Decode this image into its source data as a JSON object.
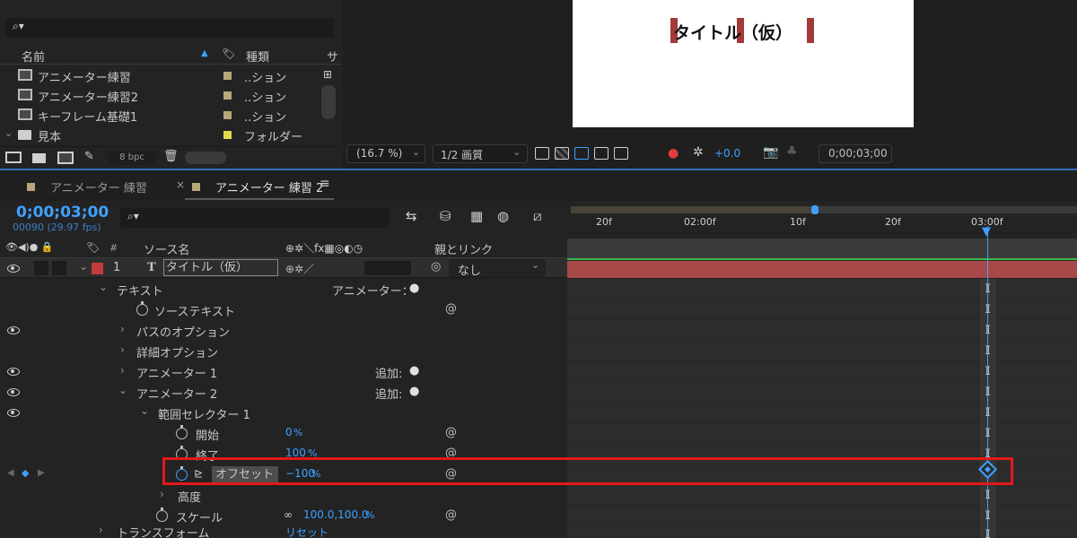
{
  "project": {
    "search_placeholder": "",
    "columns": {
      "name": "名前",
      "type": "種類",
      "size": "サ"
    },
    "items": [
      {
        "label": "アニメーター練習",
        "type": "..ション"
      },
      {
        "label": "アニメーター練習2",
        "type": "..ション"
      },
      {
        "label": "キーフレーム基礎1",
        "type": "..ション"
      },
      {
        "label": "見本",
        "type": "フォルダー"
      }
    ],
    "bpc": "8 bpc"
  },
  "viewer": {
    "title_text": "タイトル（仮）",
    "zoom": "(16.7 %)",
    "resolution": "1/2 画質",
    "exposure": "+0.0",
    "timecode": "0;00;03;00"
  },
  "tabs": [
    {
      "label": "アニメーター 練習"
    },
    {
      "label": "アニメーター 練習 2"
    }
  ],
  "timeline": {
    "current_time": "0;00;03;00",
    "frame_info": "00090 (29.97 fps)",
    "ruler": [
      "20f",
      "02:00f",
      "10f",
      "20f",
      "03:00f"
    ],
    "col_source_name": "ソース名",
    "col_parent": "親とリンク",
    "layer": {
      "number": "1",
      "type_glyph": "T",
      "name": "タイトル（仮）",
      "parent": "なし"
    }
  },
  "properties": {
    "text": "テキスト",
    "animator_label": "アニメーター：",
    "source_text": "ソーステキスト",
    "path_options": "パスのオプション",
    "more_options": "詳細オプション",
    "animator1": "アニメーター 1",
    "animator2": "アニメーター 2",
    "add_label": "追加:",
    "range_selector": "範囲セレクター 1",
    "start": {
      "label": "開始",
      "value": "0",
      "unit": "%"
    },
    "end": {
      "label": "終了",
      "value": "100",
      "unit": "%"
    },
    "offset": {
      "label": "オフセット",
      "value": "−100",
      "unit": "%"
    },
    "height": "高度",
    "scale": {
      "label": "スケール",
      "value": "100.0,100.0",
      "unit": "%"
    },
    "transform": "トランスフォーム",
    "reset": "リセット"
  },
  "colors": {
    "accent_blue": "#3ea1ff",
    "highlight_red": "#e31919",
    "layer_red": "#b33a3a",
    "track_green": "#3cb84a"
  }
}
